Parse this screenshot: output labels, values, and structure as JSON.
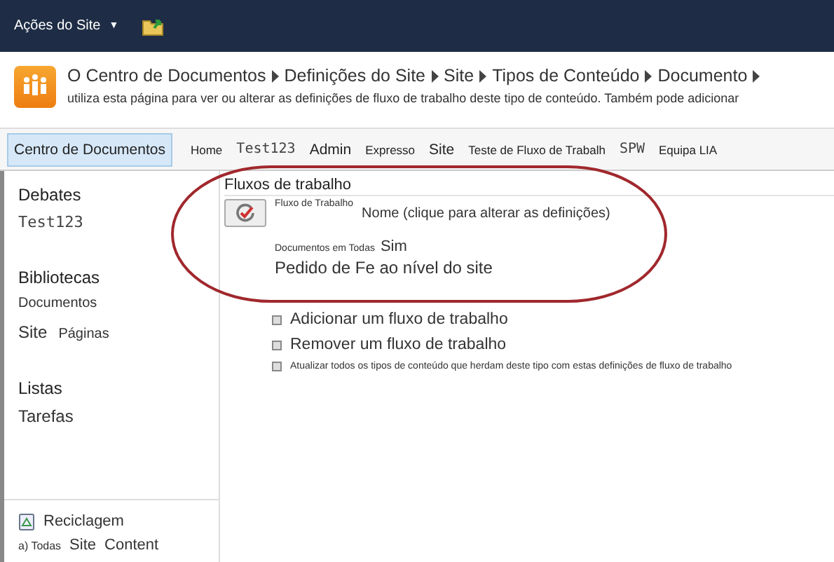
{
  "top_bar": {
    "menu_label": "Ações do Site",
    "menu_caret": "▼"
  },
  "header": {
    "breadcrumb": [
      {
        "label": "O Centro de Documentos"
      },
      {
        "label": "Definições do Site"
      },
      {
        "label": "Site"
      },
      {
        "label": "Tipos de Conteúdo"
      },
      {
        "label": "Documento"
      }
    ],
    "description": "utiliza esta página para ver ou alterar as definições de fluxo de trabalho deste tipo de conteúdo. Também pode adicionar"
  },
  "nav_tabs": [
    {
      "label": "Centro de Documentos",
      "selected": true,
      "kind": "plain"
    },
    {
      "label": "Home",
      "selected": false,
      "kind": "small"
    },
    {
      "label": "Test123",
      "selected": false,
      "kind": "mono"
    },
    {
      "label": "Admin",
      "selected": false,
      "kind": "plain"
    },
    {
      "label": "Expresso",
      "selected": false,
      "kind": "small"
    },
    {
      "label": "Site",
      "selected": false,
      "kind": "plain"
    },
    {
      "label": "Teste de Fluxo de Trabalh",
      "selected": false,
      "kind": "small"
    },
    {
      "label": "SPW",
      "selected": false,
      "kind": "mono"
    },
    {
      "label": "Equipa LIA",
      "selected": false,
      "kind": "small"
    }
  ],
  "sidebar": {
    "groups": [
      {
        "heading": "Debates",
        "items": [
          {
            "label": "Test123",
            "kind": "mono"
          }
        ]
      },
      {
        "heading": "Bibliotecas",
        "items": [
          {
            "label": "Documentos",
            "kind": "small"
          },
          {
            "label": "Site",
            "kind": "plain",
            "extra": "Páginas"
          }
        ]
      },
      {
        "heading": "Listas",
        "items": [
          {
            "label": "Tarefas",
            "kind": "plain"
          }
        ]
      }
    ],
    "recycle_bin": "Reciclagem",
    "all_content": [
      "a) Todas",
      "Site",
      "Content"
    ]
  },
  "content": {
    "title": "Fluxos de trabalho",
    "column_header": "Fluxo de Trabalho",
    "name_header": "Nome (clique para alterar as definições)",
    "row_header": "Documentos em Todas",
    "row_value": "Sim",
    "workflow_name": "Pedido de Fe ao nível do site",
    "links": [
      {
        "label": "Adicionar um fluxo de trabalho",
        "kind": "large"
      },
      {
        "label": "Remover um fluxo de trabalho",
        "kind": "large"
      },
      {
        "label": "Atualizar todos os tipos de conteúdo que herdam deste tipo com estas definições de fluxo de trabalho",
        "kind": "small"
      }
    ]
  }
}
